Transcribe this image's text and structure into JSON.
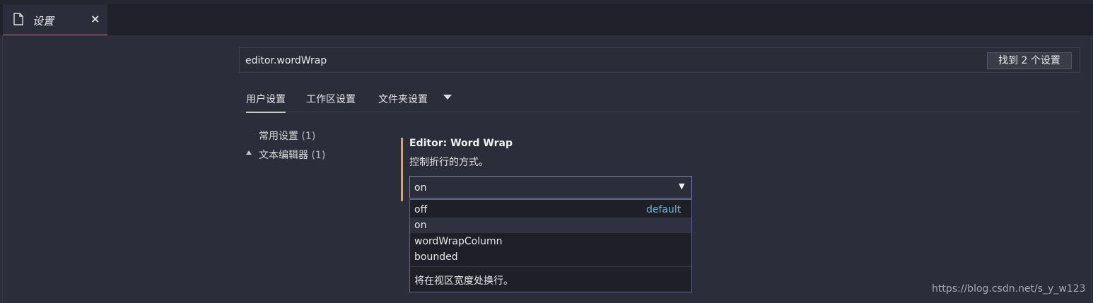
{
  "tab": {
    "label": "设置",
    "close_glyph": "×",
    "icon": "document-icon"
  },
  "search": {
    "value": "editor.wordWrap",
    "found_label": "找到 2 个设置"
  },
  "scope_tabs": [
    {
      "label": "用户设置",
      "active": true
    },
    {
      "label": "工作区设置",
      "active": false
    },
    {
      "label": "文件夹设置",
      "active": false
    }
  ],
  "toc": [
    {
      "label": "常用设置",
      "count": "(1)"
    },
    {
      "label": "文本编辑器",
      "count": "(1)"
    }
  ],
  "setting": {
    "title": "Editor: Word Wrap",
    "description": "控制折行的方式。",
    "current_value": "on",
    "options": [
      {
        "label": "off",
        "tag": "default"
      },
      {
        "label": "on",
        "tag": ""
      },
      {
        "label": "wordWrapColumn",
        "tag": ""
      },
      {
        "label": "bounded",
        "tag": ""
      }
    ],
    "option_description": "将在视区宽度处换行。"
  },
  "watermark": "https://blog.csdn.net/s_y_w123",
  "colors": {
    "accent_modified": "#e8a24e",
    "default_tag": "#6fb4d8",
    "tab_underline": "#d46a8a"
  }
}
